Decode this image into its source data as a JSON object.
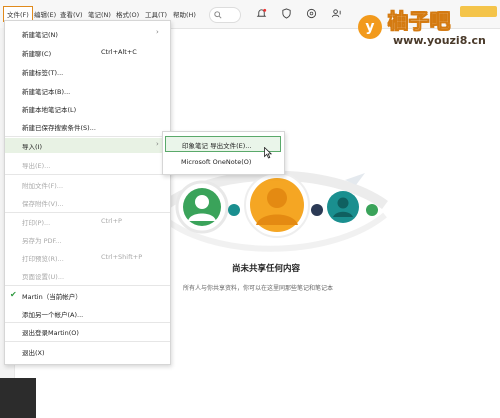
{
  "menubar": {
    "items": [
      {
        "label": "文件(F)"
      },
      {
        "label": "编辑(E)"
      },
      {
        "label": "查看(V)"
      },
      {
        "label": "笔记(N)"
      },
      {
        "label": "格式(O)"
      },
      {
        "label": "工具(T)"
      },
      {
        "label": "帮助(H)"
      }
    ],
    "search_icon": "search-icon",
    "toolbar_icons": [
      "bell-icon",
      "shield-icon",
      "globe-icon",
      "person-add-icon"
    ]
  },
  "watermark": {
    "logo_char": "y",
    "title": "柚子吧",
    "url": "www.youzi8.cn"
  },
  "file_menu": {
    "items": [
      {
        "label": "新建笔记(N)",
        "shortcut": "",
        "submenu": true
      },
      {
        "label": "新建聊(C)",
        "shortcut": "Ctrl+Alt+C"
      },
      {
        "label": "新建标签(T)..."
      },
      {
        "label": "新建笔记本(B)..."
      },
      {
        "label": "新建本地笔记本(L)"
      },
      {
        "label": "新建已保存搜索条件(S)..."
      },
      {
        "label": "导入(I)",
        "submenu": true
      },
      {
        "label": "导出(E)..."
      },
      {
        "label": "附加文件(F)..."
      },
      {
        "label": "保存附件(V)..."
      },
      {
        "label": "打印(P)...",
        "shortcut": "Ctrl+P"
      },
      {
        "label": "另存为 PDF..."
      },
      {
        "label": "打印预览(R)...",
        "shortcut": "Ctrl+Shift+P"
      },
      {
        "label": "页面设置(U)..."
      },
      {
        "label": "Martin（当前帐户）"
      },
      {
        "label": "添加另一个帐户(A)..."
      },
      {
        "label": "退出登录Martin(O)"
      },
      {
        "label": "退出(X)"
      }
    ]
  },
  "import_submenu": {
    "items": [
      {
        "label": "印象笔记 导出文件(E)..."
      },
      {
        "label": "Microsoft OneNote(O)"
      }
    ]
  },
  "empty_state": {
    "title": "尚未共享任何内容",
    "description": "所有人与你共享资料，你可以在这里同那些笔记和笔记本"
  },
  "colors": {
    "accent_orange": "#e08a1c",
    "brand_green": "#2f9a3f",
    "avatar_orange": "#f5a623",
    "avatar_teal": "#1a8f8f"
  }
}
